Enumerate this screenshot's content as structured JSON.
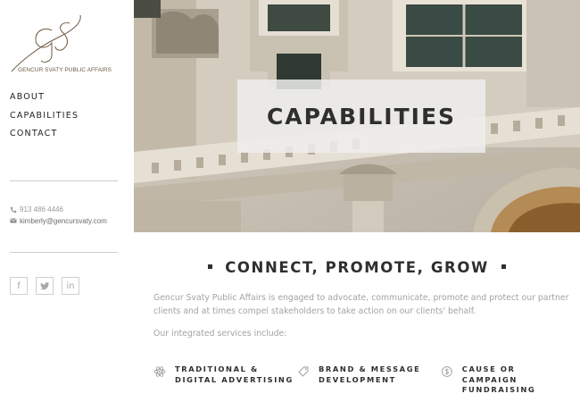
{
  "brand": {
    "monogram": "GS",
    "name": "GENCUR SVATY PUBLIC AFFAIRS"
  },
  "nav": {
    "items": [
      {
        "label": "ABOUT"
      },
      {
        "label": "CAPABILITIES"
      },
      {
        "label": "CONTACT"
      }
    ]
  },
  "contact": {
    "phone": "913 486 4446",
    "email": "kimberly@gencursvaty.com",
    "phone_icon": "phone-icon",
    "email_icon": "envelope-icon"
  },
  "social": {
    "items": [
      {
        "icon": "facebook-icon",
        "glyph": "f"
      },
      {
        "icon": "twitter-icon",
        "glyph": "t"
      },
      {
        "icon": "linkedin-icon",
        "glyph": "in"
      }
    ]
  },
  "hero": {
    "title": "CAPABILITIES"
  },
  "main": {
    "heading": "CONNECT, PROMOTE, GROW",
    "intro": "Gencur Svaty Public Affairs is engaged to advocate, communicate, promote and protect our partner clients and at times compel stakeholders to take action on our clients' behalf.",
    "services_intro": "Our integrated services include:",
    "services": [
      {
        "icon": "atom-icon",
        "line1": "TRADITIONAL &",
        "line2": "DIGITAL ADVERTISING"
      },
      {
        "icon": "tag-icon",
        "line1": "BRAND & MESSAGE",
        "line2": "DEVELOPMENT"
      },
      {
        "icon": "coin-icon",
        "line1": "CAUSE OR CAMPAIGN",
        "line2": "FUNDRAISING"
      }
    ]
  },
  "colors": {
    "brand": "#6e5a44",
    "text_dark": "#2f2f2f",
    "text_muted": "#a3a3a3"
  }
}
